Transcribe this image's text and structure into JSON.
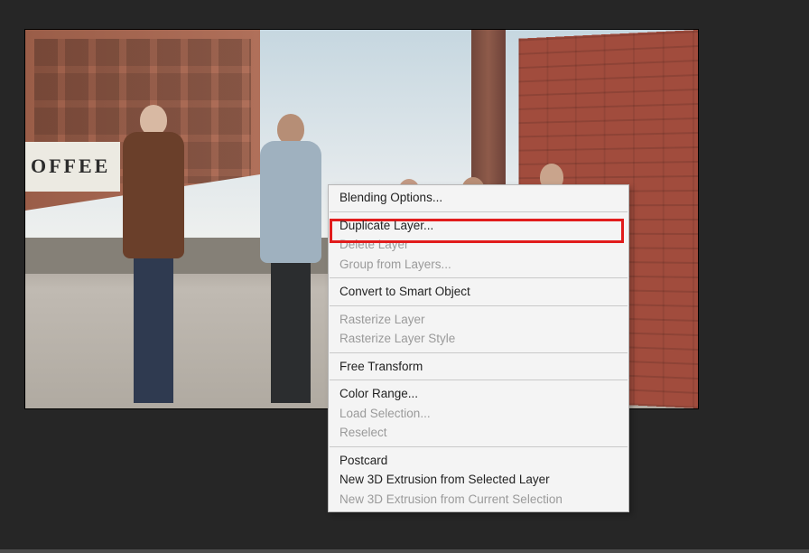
{
  "canvas": {
    "awning_text": "OFFEE"
  },
  "context_menu": {
    "items": [
      {
        "label": "Blending Options...",
        "enabled": true,
        "highlighted": false
      },
      {
        "sep": true
      },
      {
        "label": "Duplicate Layer...",
        "enabled": true,
        "highlighted": true
      },
      {
        "label": "Delete Layer",
        "enabled": false,
        "highlighted": false
      },
      {
        "label": "Group from Layers...",
        "enabled": false,
        "highlighted": false
      },
      {
        "sep": true
      },
      {
        "label": "Convert to Smart Object",
        "enabled": true,
        "highlighted": false
      },
      {
        "sep": true
      },
      {
        "label": "Rasterize Layer",
        "enabled": false,
        "highlighted": false
      },
      {
        "label": "Rasterize Layer Style",
        "enabled": false,
        "highlighted": false
      },
      {
        "sep": true
      },
      {
        "label": "Free Transform",
        "enabled": true,
        "highlighted": false
      },
      {
        "sep": true
      },
      {
        "label": "Color Range...",
        "enabled": true,
        "highlighted": false
      },
      {
        "label": "Load Selection...",
        "enabled": false,
        "highlighted": false
      },
      {
        "label": "Reselect",
        "enabled": false,
        "highlighted": false
      },
      {
        "sep": true
      },
      {
        "label": "Postcard",
        "enabled": true,
        "highlighted": false
      },
      {
        "label": "New 3D Extrusion from Selected Layer",
        "enabled": true,
        "highlighted": false
      },
      {
        "label": "New 3D Extrusion from Current Selection",
        "enabled": false,
        "highlighted": false
      }
    ]
  }
}
